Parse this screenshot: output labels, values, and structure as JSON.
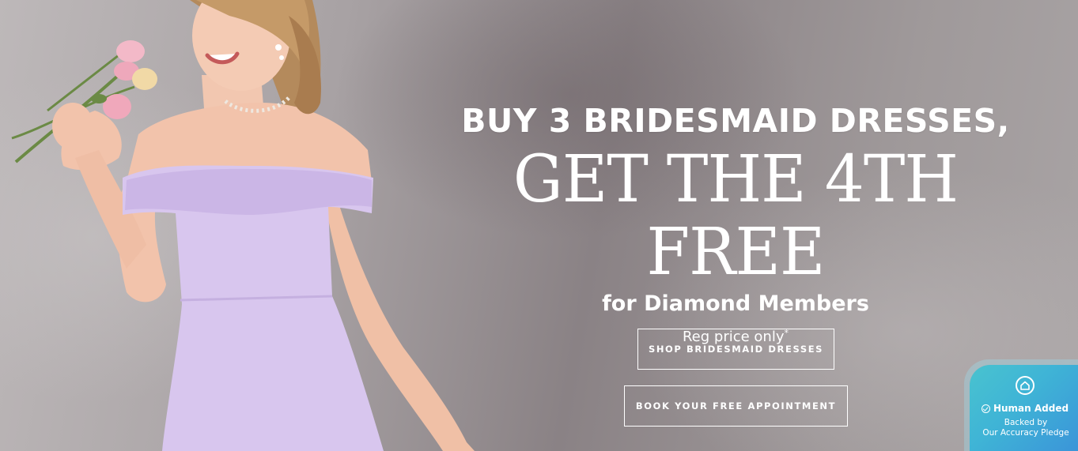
{
  "hero": {
    "headline_line1": "BUY 3 BRIDESMAID DRESSES,",
    "headline_line2": "GET THE 4TH FREE",
    "headline_line3": "for Diamond Members",
    "fineprint": "Reg price only",
    "fineprint_mark": "*",
    "image_description": "Smiling woman in an off-the-shoulder lilac bridesmaid dress holding pink flowers"
  },
  "buttons": {
    "shop_label": "SHOP BRIDESMAID DRESSES",
    "book_label": "BOOK YOUR FREE APPOINTMENT"
  },
  "badge": {
    "icon": "home-icon",
    "title": "Human Added",
    "subtitle_line1": "Backed by",
    "subtitle_line2": "Our Accuracy Pledge"
  },
  "colors": {
    "dress": "#d8c6ee",
    "badge_start": "#49c3cf",
    "badge_end": "#3a8fd9",
    "text": "#ffffff"
  }
}
